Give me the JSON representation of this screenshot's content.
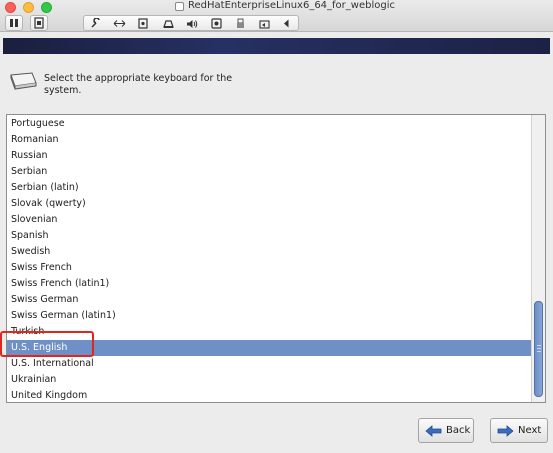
{
  "window": {
    "title": "RedHatEnterpriseLinux6_64_for_weblogic"
  },
  "toolbar": {
    "buttons": [
      {
        "name": "pause-icon"
      },
      {
        "name": "snapshot-icon"
      }
    ],
    "tools": [
      {
        "name": "settings-wrench-icon"
      },
      {
        "name": "network-arrows-icon"
      },
      {
        "name": "disk-icon"
      },
      {
        "name": "harddrive-icon"
      },
      {
        "name": "speaker-icon"
      },
      {
        "name": "camera-icon"
      },
      {
        "name": "usb-icon"
      },
      {
        "name": "folder-share-icon"
      },
      {
        "name": "chevron-left-icon"
      }
    ]
  },
  "installer": {
    "prompt": "Select the appropriate keyboard for the system.",
    "keyboards": [
      "Portuguese",
      "Romanian",
      "Russian",
      "Serbian",
      "Serbian (latin)",
      "Slovak (qwerty)",
      "Slovenian",
      "Spanish",
      "Swedish",
      "Swiss French",
      "Swiss French (latin1)",
      "Swiss German",
      "Swiss German (latin1)",
      "Turkish",
      "U.S. English",
      "U.S. International",
      "Ukrainian",
      "United Kingdom"
    ],
    "selected": "U.S. English",
    "back_label": "Back",
    "next_label": "Next"
  },
  "colors": {
    "selection": "#6f90c7",
    "highlight": "#e0271f",
    "banner": "#1a1f3e"
  }
}
